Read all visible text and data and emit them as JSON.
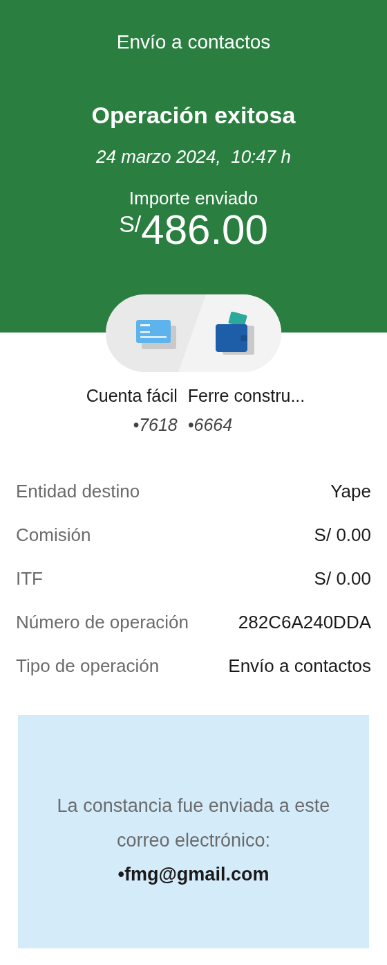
{
  "header": {
    "title": "Envío a contactos",
    "status": "Operación exitosa",
    "datetime": "24 marzo 2024,  10:47 h",
    "amount_label": "Importe enviado",
    "amount_currency": "S/",
    "amount_value": "486.00"
  },
  "accounts": [
    {
      "kind": "card",
      "name": "Cuenta fácil",
      "number": "•7618"
    },
    {
      "kind": "wallet",
      "name": "Ferre constru...",
      "number": "•6664"
    }
  ],
  "details": [
    {
      "label": "Entidad destino",
      "value": "Yape"
    },
    {
      "label": "Comisión",
      "value": "S/ 0.00"
    },
    {
      "label": "ITF",
      "value": "S/ 0.00"
    },
    {
      "label": "Número de operación",
      "value": "282C6A240DDA"
    },
    {
      "label": "Tipo de operación",
      "value": "Envío a contactos"
    }
  ],
  "notice": {
    "text": "La constancia fue enviada a este correo electrónico:",
    "email": "•fmg@gmail.com"
  }
}
